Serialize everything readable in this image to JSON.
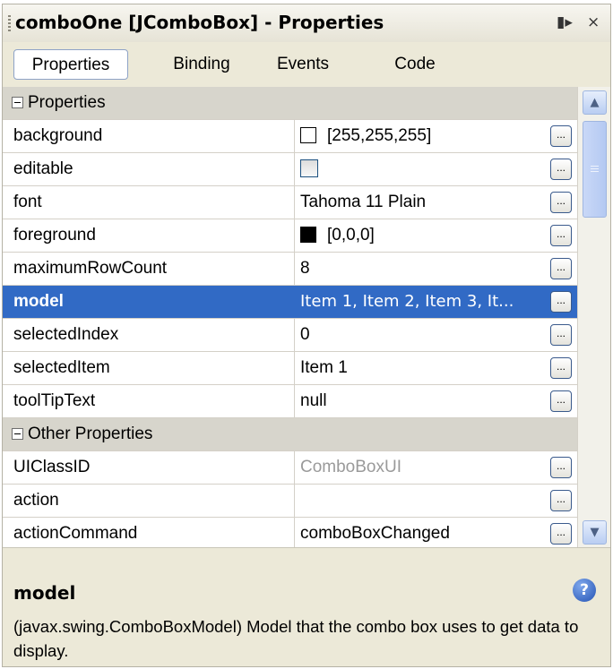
{
  "window": {
    "title": "comboOne [JComboBox] - Properties",
    "pin_glyph": "▮▸",
    "close_glyph": "×"
  },
  "tabs": [
    {
      "label": "Properties",
      "active": true
    },
    {
      "label": "Binding",
      "active": false
    },
    {
      "label": "Events",
      "active": false
    },
    {
      "label": "Code",
      "active": false
    }
  ],
  "categories": {
    "properties": "Properties",
    "other": "Other Properties"
  },
  "rows": {
    "background": {
      "name": "background",
      "value": "[255,255,255]",
      "swatch": "#ffffff"
    },
    "editable": {
      "name": "editable",
      "value": ""
    },
    "font": {
      "name": "font",
      "value": "Tahoma 11 Plain"
    },
    "foreground": {
      "name": "foreground",
      "value": "[0,0,0]",
      "swatch": "#000000"
    },
    "maximumRowCount": {
      "name": "maximumRowCount",
      "value": "8"
    },
    "model": {
      "name": "model",
      "value": "Item 1, Item 2, Item 3, It..."
    },
    "selectedIndex": {
      "name": "selectedIndex",
      "value": "0"
    },
    "selectedItem": {
      "name": "selectedItem",
      "value": "Item 1"
    },
    "toolTipText": {
      "name": "toolTipText",
      "value": "null"
    },
    "UIClassID": {
      "name": "UIClassID",
      "value": "ComboBoxUI"
    },
    "action": {
      "name": "action",
      "value": ""
    },
    "actionCommand": {
      "name": "actionCommand",
      "value": "comboBoxChanged"
    }
  },
  "ellipsis_label": "...",
  "description": {
    "title": "model",
    "text": "(javax.swing.ComboBoxModel) Model that the combo box uses to get data to display.",
    "help_glyph": "?"
  },
  "colors": {
    "selection": "#316ac5",
    "category_bg": "#d7d5cc",
    "panel_bg": "#ece9d8"
  }
}
